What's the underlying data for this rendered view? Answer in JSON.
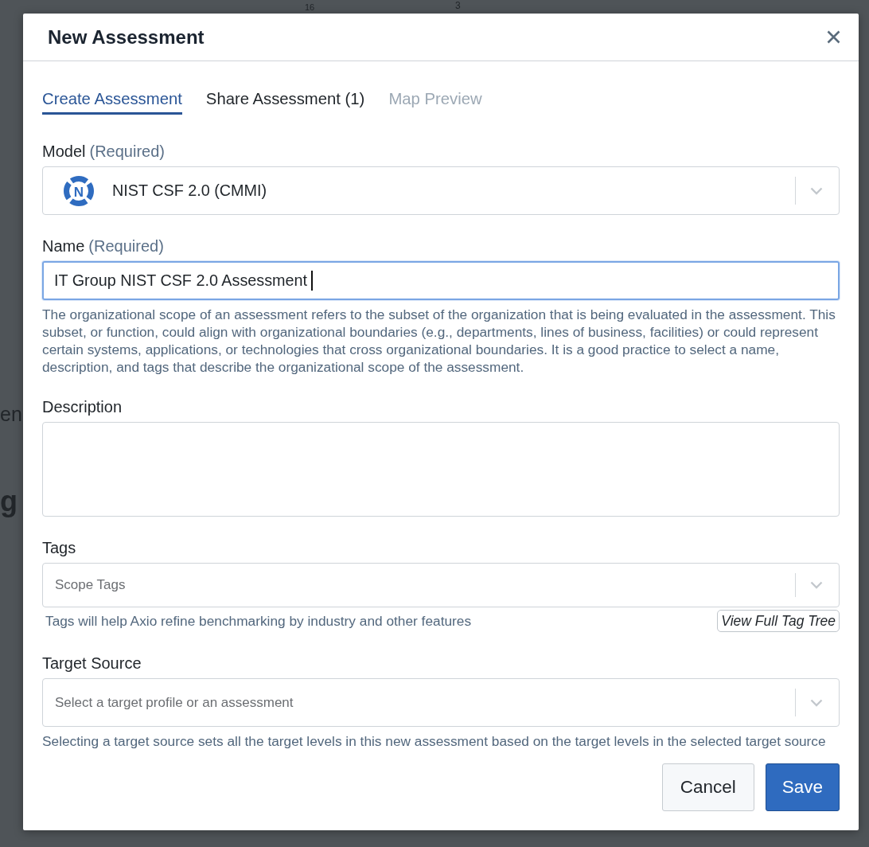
{
  "background": {
    "texts": [
      "16",
      "3",
      "en",
      "g"
    ]
  },
  "dialog": {
    "title": "New Assessment",
    "tabs": [
      {
        "label": "Create Assessment",
        "selected": true,
        "disabled": false
      },
      {
        "label": "Share Assessment (1)",
        "selected": false,
        "disabled": false
      },
      {
        "label": "Map Preview",
        "selected": false,
        "disabled": true
      }
    ],
    "fields": [
      {
        "kind": "select",
        "label": "Model",
        "note": "(Required)",
        "logo": "N",
        "value": "NIST CSF 2.0 (CMMI)"
      },
      {
        "kind": "text",
        "label": "Name",
        "note": "(Required)",
        "value": "IT Group NIST CSF 2.0 Assessment",
        "focused": true,
        "help": "The organizational scope of an assessment refers to the subset of the organization that is being evaluated in the assessment. This subset, or function, could align with organizational boundaries (e.g., departments, lines of business, facilities) or could represent certain systems, applications, or technologies that cross organizational boundaries. It is a good practice to select a name, description, and tags that describe the organizational scope of the assessment."
      },
      {
        "kind": "textarea",
        "label": "Description"
      },
      {
        "kind": "multiselect",
        "label": "Tags",
        "placeholder": "Scope Tags",
        "help": "Tags will help Axio refine benchmarking by industry and other features",
        "link": "View Full Tag Tree"
      },
      {
        "kind": "select",
        "label": "Target Source",
        "placeholder": "Select a target profile or an assessment",
        "help": "Selecting a target source sets all the target levels in this new assessment based on the target levels in the selected target source"
      }
    ],
    "buttons": [
      {
        "label": "Cancel",
        "kind": "secondary"
      },
      {
        "label": "Save",
        "kind": "primary"
      }
    ]
  }
}
